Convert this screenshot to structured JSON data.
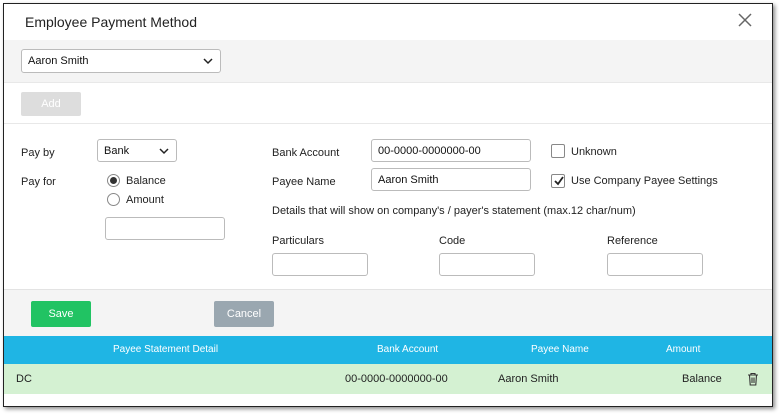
{
  "dialog": {
    "title": "Employee Payment Method"
  },
  "employee_select": {
    "value": "Aaron Smith"
  },
  "toolbar": {
    "add_label": "Add"
  },
  "form": {
    "pay_by_label": "Pay by",
    "pay_by_value": "Bank",
    "pay_for_label": "Pay for",
    "pay_for_options": [
      "Balance",
      "Amount"
    ],
    "pay_for_selected": "Balance",
    "amount_value": "",
    "bank_account_label": "Bank Account",
    "bank_account_value": "00-0000-0000000-00",
    "unknown_label": "Unknown",
    "unknown_checked": false,
    "payee_name_label": "Payee Name",
    "payee_name_value": "Aaron Smith",
    "use_company_label": "Use Company Payee Settings",
    "use_company_checked": true,
    "details_note": "Details that will show on company's / payer's statement (max.12 char/num)",
    "particulars_label": "Particulars",
    "code_label": "Code",
    "reference_label": "Reference",
    "particulars_value": "",
    "code_value": "",
    "reference_value": ""
  },
  "actions": {
    "save_label": "Save",
    "cancel_label": "Cancel"
  },
  "table": {
    "columns": [
      "Payee Statement Detail",
      "Bank Account",
      "Payee Name",
      "Amount"
    ],
    "rows": [
      {
        "detail": "DC",
        "bank_account": "00-0000-0000000-00",
        "payee_name": "Aaron Smith",
        "amount": "Balance"
      }
    ]
  },
  "colors": {
    "save": "#21c363",
    "cancel": "#9aa7b0",
    "table_header": "#1fb5e4",
    "row_highlight": "#d4f1d2"
  },
  "icons": [
    "close-icon",
    "chevron-down-icon",
    "check-icon",
    "trash-icon"
  ]
}
